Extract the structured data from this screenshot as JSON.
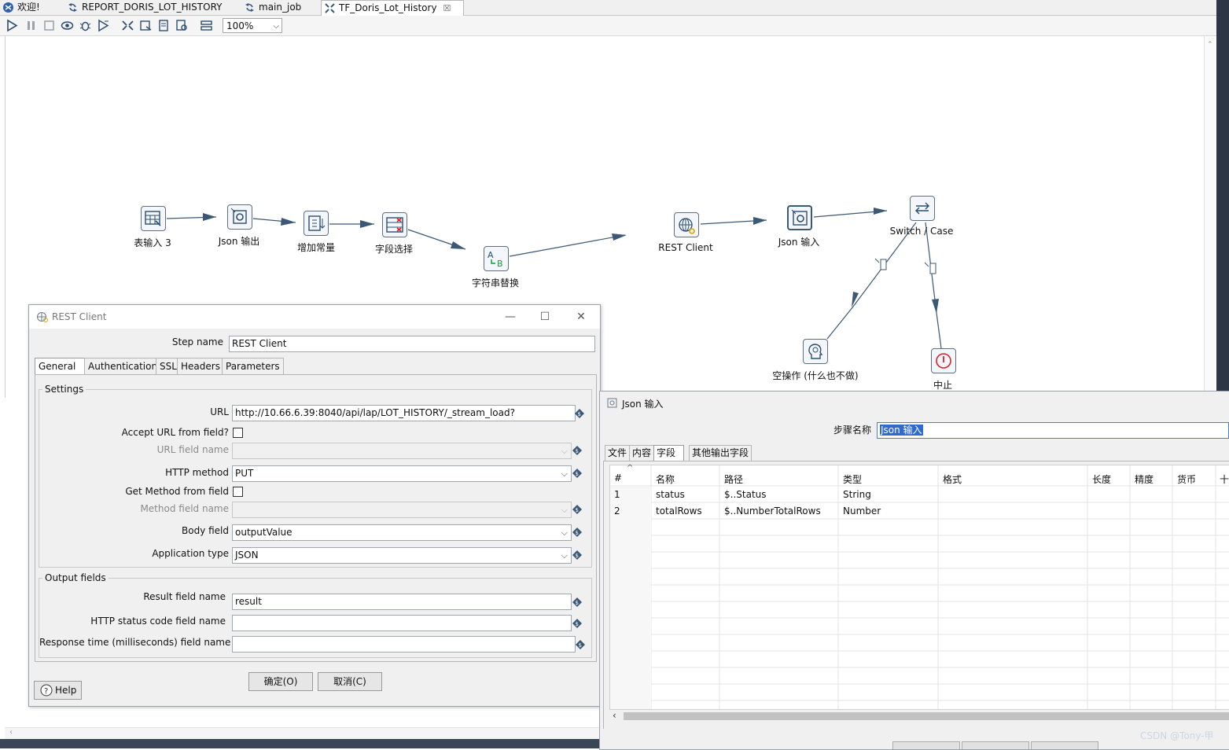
{
  "tabs": [
    {
      "label": "欢迎!"
    },
    {
      "label": "REPORT_DORIS_LOT_HISTORY"
    },
    {
      "label": "main_job"
    },
    {
      "label": "TF_Doris_Lot_History",
      "close": "☒"
    }
  ],
  "toolbar": {
    "zoom": "100%"
  },
  "steps": [
    {
      "label": "表输入 3"
    },
    {
      "label": "Json 输出"
    },
    {
      "label": "增加常量"
    },
    {
      "label": "字段选择"
    },
    {
      "label": "字符串替换"
    },
    {
      "label": "REST Client"
    },
    {
      "label": "Json 输入"
    },
    {
      "label": "Switch / Case"
    },
    {
      "label": "空操作 (什么也不做)"
    },
    {
      "label": "中止"
    }
  ],
  "rest_dialog": {
    "title": "REST Client",
    "step_name_label": "Step name",
    "step_name_value": "REST Client",
    "tabs": [
      "General",
      "Authentication",
      "SSL",
      "Headers",
      "Parameters"
    ],
    "settings_title": "Settings",
    "url_label": "URL",
    "url_value": "http://10.66.6.39:8040/api/lap/LOT_HISTORY/_stream_load?",
    "accept_url_label": "Accept URL from field?",
    "url_field_label": "URL field name",
    "http_method_label": "HTTP method",
    "http_method_value": "PUT",
    "get_method_label": "Get Method from field",
    "method_field_label": "Method field name",
    "body_field_label": "Body field",
    "body_field_value": "outputValue",
    "app_type_label": "Application type",
    "app_type_value": "JSON",
    "output_title": "Output fields",
    "result_label": "Result field name",
    "result_value": "result",
    "status_label": "HTTP status code field name",
    "resp_label": "Response time (milliseconds) field name",
    "help": "Help",
    "ok": "确定(O)",
    "cancel": "取消(C)"
  },
  "json_dialog": {
    "title": "Json 输入",
    "step_name_label": "步骤名称",
    "step_name_value": "Json 输入",
    "tabs": [
      "文件",
      "内容",
      "字段",
      "其他输出字段"
    ],
    "columns": [
      "#",
      "名称",
      "路径",
      "类型",
      "格式",
      "长度",
      "精度",
      "货币",
      "十"
    ],
    "rows": [
      {
        "n": "1",
        "name": "status",
        "path": "$..Status",
        "type": "String"
      },
      {
        "n": "2",
        "name": "totalRows",
        "path": "$..NumberTotalRows",
        "type": "Number"
      }
    ]
  },
  "watermark": "CSDN @Tony-甲"
}
